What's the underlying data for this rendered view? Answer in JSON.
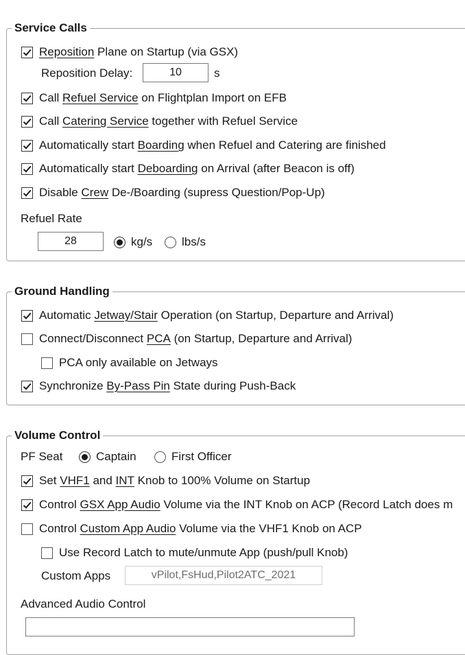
{
  "service_calls": {
    "title": "Service Calls",
    "reposition": {
      "checked": true,
      "link": "Reposition",
      "rest": " Plane on Startup (via GSX)"
    },
    "reposition_delay": {
      "label": "Reposition Delay:",
      "value": "10",
      "unit": "s"
    },
    "refuel": {
      "checked": true,
      "pre": "Call ",
      "link": "Refuel Service",
      "rest": " on Flightplan Import on EFB"
    },
    "catering": {
      "checked": true,
      "pre": "Call ",
      "link": "Catering Service",
      "rest": " together with Refuel Service"
    },
    "boarding": {
      "checked": true,
      "pre": "Automatically start ",
      "link": "Boarding",
      "rest": " when Refuel and Catering are finished"
    },
    "deboarding": {
      "checked": true,
      "pre": "Automatically start ",
      "link": "Deboarding",
      "rest": " on Arrival (after Beacon is off)"
    },
    "crew": {
      "checked": true,
      "pre": "Disable ",
      "link": "Crew",
      "rest": " De-/Boarding (supress Question/Pop-Up)"
    },
    "refuel_rate": {
      "label": "Refuel Rate",
      "value": "28",
      "unit_kg": "kg/s",
      "unit_lbs": "lbs/s",
      "selected": "kg/s"
    }
  },
  "ground_handling": {
    "title": "Ground Handling",
    "jetway": {
      "checked": true,
      "pre": "Automatic ",
      "link": "Jetway/Stair",
      "rest": " Operation (on Startup, Departure and Arrival)"
    },
    "pca": {
      "checked": false,
      "pre": "Connect/Disconnect ",
      "link": "PCA",
      "rest": " (on Startup, Departure and Arrival)"
    },
    "pca_jetways": {
      "checked": false,
      "label": "PCA only available on Jetways"
    },
    "bypass": {
      "checked": true,
      "pre": "Synchronize ",
      "link": "By-Pass Pin",
      "rest": " State during Push-Back"
    }
  },
  "volume_control": {
    "title": "Volume Control",
    "pf_seat": {
      "label": "PF Seat",
      "captain": "Captain",
      "first_officer": "First Officer",
      "selected": "Captain"
    },
    "vhf1": {
      "checked": true,
      "pre": "Set ",
      "link1": "VHF1",
      "mid": " and ",
      "link2": "INT",
      "rest": " Knob to 100% Volume on Startup"
    },
    "gsx_audio": {
      "checked": true,
      "pre": "Control ",
      "link": "GSX App Audio",
      "rest": " Volume via the INT Knob on ACP (Record Latch does m"
    },
    "custom_audio": {
      "checked": false,
      "pre": "Control ",
      "link": "Custom App Audio",
      "rest": " Volume via the VHF1 Knob on ACP"
    },
    "record_latch": {
      "checked": false,
      "label": "Use Record Latch to mute/unmute App (push/pull Knob)"
    },
    "custom_apps": {
      "label": "Custom Apps",
      "value": "vPilot,FsHud,Pilot2ATC_2021"
    },
    "advanced": {
      "label": "Advanced Audio Control",
      "value": ""
    }
  }
}
